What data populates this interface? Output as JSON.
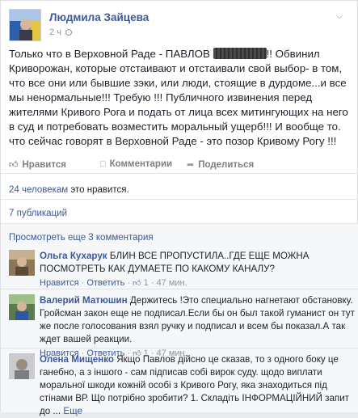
{
  "post": {
    "author": "Людмила Зайцева",
    "time": "2 ч",
    "text_before": "Только что в Верховной Раде - ПАВЛОВ",
    "text_after": "!! Обвинил Криворожан, которые отстаивают и отстаивали свой выбор- в том, что все они или бывшие зэки, или люди, стоящие в дурдоме...и все мы ненормальные!!! Требую !!! Публичного извинения перед жителями Кривого Рога и подать от лица всех митингующих на него в суд и потребовать возместить моральный ущерб!!! И вообще то. что сейчас говорят в Верховной Раде - это позор Кривому Рогу !!!"
  },
  "actions": {
    "like": "Нравится",
    "comment": "Комментарии",
    "share": "Поделиться"
  },
  "likes": {
    "count_link": "24 человекам",
    "suffix": " это нравится."
  },
  "shares": "7 публикаций",
  "comments_section": {
    "view_more": "Просмотреть еще 3 комментария",
    "items": [
      {
        "name": "Ольга Кухарук",
        "text": "БЛИН ВСЕ ПРОПУСТИЛА..ГДЕ ЕЩЕ МОЖНА ПОСМОТРЕТЬ КАК ДУМАЕТЕ ПО КАКОМУ КАНАЛУ?",
        "like": "Нравится",
        "reply": "Ответить",
        "count": "1",
        "time": "47 мин."
      },
      {
        "name": "Валерий Матюшин",
        "text": "Держитесь !Это специально нагнетают обстановку. Гройсман закон еще не подписал.Если бы он был такой гуманист он тут же после голосования взял ручку и подписал и всем бы показал.А так ждет вашей реакции.",
        "like": "Нравится",
        "reply": "Ответить",
        "count": "1",
        "time": "47 мин."
      },
      {
        "name": "Олена Мищенко",
        "text": "Якщо Павлов дійсно це сказав, то з одного боку це ганебно, а з іншого - сам підписав собі вирок суду. щодо виплати моральної шкоди кожній особі з Кривого Рогу, яка знаходиться під стінами ВР. Що потрібно зробити? 1. Складіть ІНФОРМАЦІЙНИЙ запит до ...",
        "more": "Еще"
      }
    ]
  },
  "colors": {
    "link": "#3b5998",
    "muted": "#90949c",
    "bg": "#f6f7f9"
  }
}
